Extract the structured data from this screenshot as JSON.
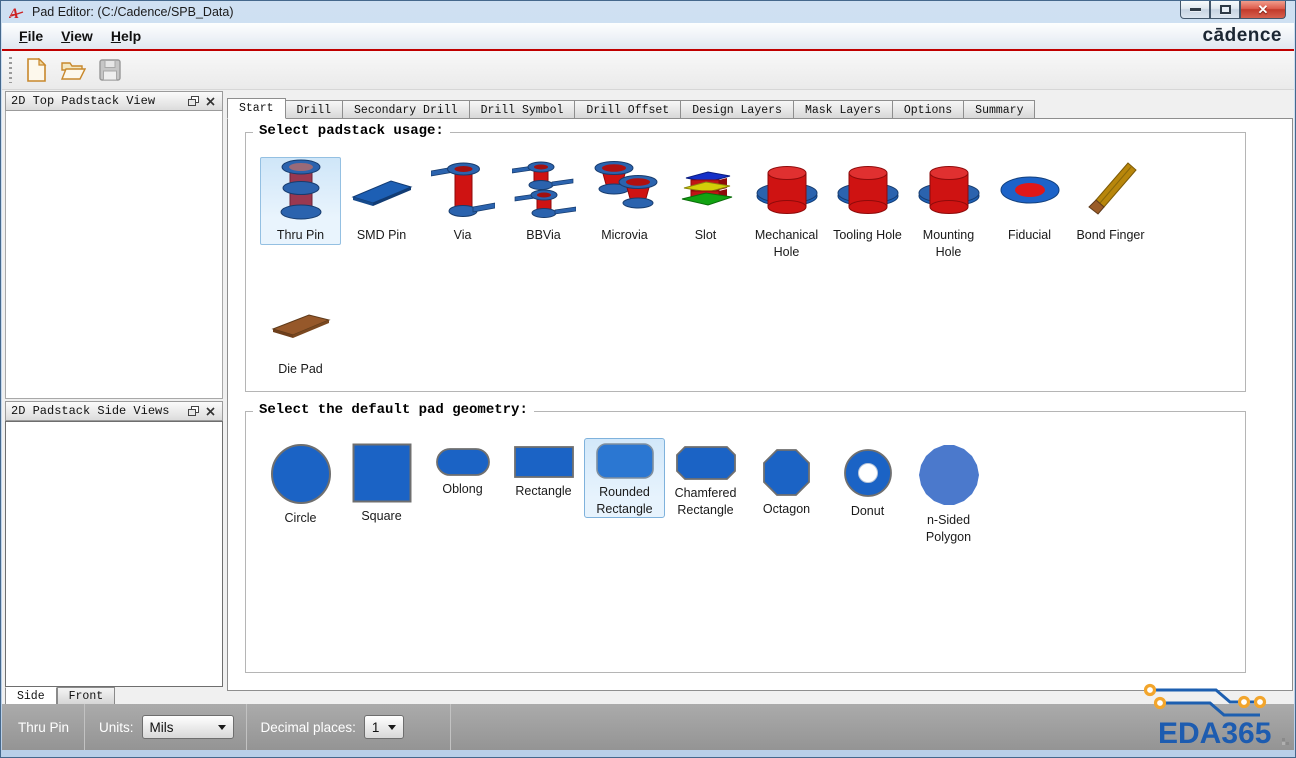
{
  "window": {
    "title": "Pad Editor:  (C:/Cadence/SPB_Data)"
  },
  "menu": {
    "items": [
      {
        "key": "F",
        "rest": "ile"
      },
      {
        "key": "V",
        "rest": "iew"
      },
      {
        "key": "H",
        "rest": "elp"
      }
    ],
    "brand": "cādence"
  },
  "toolbar": {
    "buttons": [
      "new-file",
      "open-file",
      "save-file"
    ]
  },
  "panels": {
    "top_view": {
      "title": "2D Top Padstack View"
    },
    "side_views": {
      "title": "2D Padstack Side Views"
    },
    "side_tabs": [
      {
        "label": "Side",
        "active": true
      },
      {
        "label": "Front",
        "active": false
      }
    ]
  },
  "tabs": [
    {
      "label": "Start",
      "active": true
    },
    {
      "label": "Drill"
    },
    {
      "label": "Secondary Drill"
    },
    {
      "label": "Drill Symbol"
    },
    {
      "label": "Drill Offset"
    },
    {
      "label": "Design Layers"
    },
    {
      "label": "Mask Layers"
    },
    {
      "label": "Options"
    },
    {
      "label": "Summary"
    }
  ],
  "usage": {
    "title": "Select padstack usage:",
    "items": [
      {
        "label": "Thru Pin",
        "icon": "thru-pin-icon",
        "selected": true
      },
      {
        "label": "SMD Pin",
        "icon": "smd-pin-icon",
        "selected": false
      },
      {
        "label": "Via",
        "icon": "via-icon",
        "selected": false
      },
      {
        "label": "BBVia",
        "icon": "bbvia-icon",
        "selected": false
      },
      {
        "label": "Microvia",
        "icon": "microvia-icon",
        "selected": false
      },
      {
        "label": "Slot",
        "icon": "slot-icon",
        "selected": false
      },
      {
        "label": "Mechanical Hole",
        "icon": "mechanical-hole-icon",
        "selected": false
      },
      {
        "label": "Tooling Hole",
        "icon": "tooling-hole-icon",
        "selected": false
      },
      {
        "label": "Mounting Hole",
        "icon": "mounting-hole-icon",
        "selected": false
      },
      {
        "label": "Fiducial",
        "icon": "fiducial-icon",
        "selected": false
      },
      {
        "label": "Bond Finger",
        "icon": "bond-finger-icon",
        "selected": false
      },
      {
        "label": "Die Pad",
        "icon": "die-pad-icon",
        "selected": false
      }
    ]
  },
  "geometry": {
    "title": "Select the default pad geometry:",
    "items": [
      {
        "label": "Circle",
        "icon": "circle-shape-icon",
        "selected": false
      },
      {
        "label": "Square",
        "icon": "square-shape-icon",
        "selected": false
      },
      {
        "label": "Oblong",
        "icon": "oblong-shape-icon",
        "selected": false
      },
      {
        "label": "Rectangle",
        "icon": "rectangle-shape-icon",
        "selected": false
      },
      {
        "label": "Rounded Rectangle",
        "icon": "rounded-rectangle-shape-icon",
        "selected": true
      },
      {
        "label": "Chamfered Rectangle",
        "icon": "chamfered-rectangle-shape-icon",
        "selected": false
      },
      {
        "label": "Octagon",
        "icon": "octagon-shape-icon",
        "selected": false
      },
      {
        "label": "Donut",
        "icon": "donut-shape-icon",
        "selected": false
      },
      {
        "label": "n-Sided Polygon",
        "icon": "n-sided-polygon-shape-icon",
        "selected": false
      }
    ]
  },
  "status_bar": {
    "mode": "Thru Pin",
    "units_label": "Units:",
    "units_value": "Mils",
    "decimal_label": "Decimal places:",
    "decimal_value": "1"
  },
  "watermark": {
    "text": "EDA365"
  },
  "colors": {
    "menu_accent": "#c00000",
    "pad_blue": "#1b63c5",
    "pad_blue_light": "#4b79cc",
    "selection_fill": "#d6e9fa",
    "selection_border": "#8fbde2",
    "status_bar_gray": "#9b9b9b",
    "watermark_blue": "#1d5cb0",
    "pin_maroon": "#9a3850",
    "via_red": "#cf1312",
    "flange_blue": "#2b63ae"
  }
}
